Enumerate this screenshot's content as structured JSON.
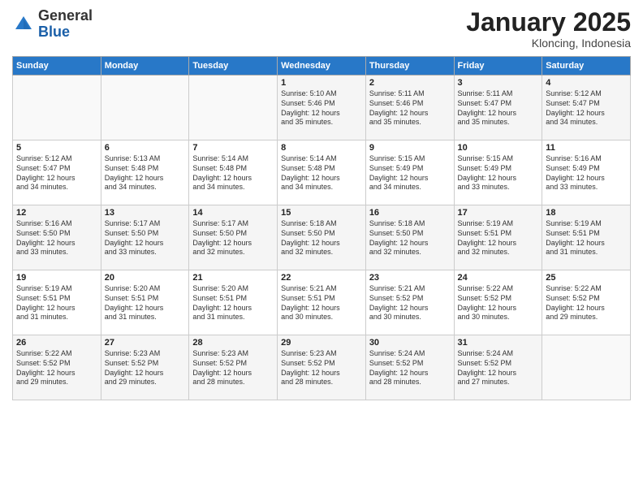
{
  "logo": {
    "general": "General",
    "blue": "Blue"
  },
  "header": {
    "month": "January 2025",
    "location": "Kloncing, Indonesia"
  },
  "weekdays": [
    "Sunday",
    "Monday",
    "Tuesday",
    "Wednesday",
    "Thursday",
    "Friday",
    "Saturday"
  ],
  "weeks": [
    [
      {
        "day": "",
        "content": ""
      },
      {
        "day": "",
        "content": ""
      },
      {
        "day": "",
        "content": ""
      },
      {
        "day": "1",
        "content": "Sunrise: 5:10 AM\nSunset: 5:46 PM\nDaylight: 12 hours\nand 35 minutes."
      },
      {
        "day": "2",
        "content": "Sunrise: 5:11 AM\nSunset: 5:46 PM\nDaylight: 12 hours\nand 35 minutes."
      },
      {
        "day": "3",
        "content": "Sunrise: 5:11 AM\nSunset: 5:47 PM\nDaylight: 12 hours\nand 35 minutes."
      },
      {
        "day": "4",
        "content": "Sunrise: 5:12 AM\nSunset: 5:47 PM\nDaylight: 12 hours\nand 34 minutes."
      }
    ],
    [
      {
        "day": "5",
        "content": "Sunrise: 5:12 AM\nSunset: 5:47 PM\nDaylight: 12 hours\nand 34 minutes."
      },
      {
        "day": "6",
        "content": "Sunrise: 5:13 AM\nSunset: 5:48 PM\nDaylight: 12 hours\nand 34 minutes."
      },
      {
        "day": "7",
        "content": "Sunrise: 5:14 AM\nSunset: 5:48 PM\nDaylight: 12 hours\nand 34 minutes."
      },
      {
        "day": "8",
        "content": "Sunrise: 5:14 AM\nSunset: 5:48 PM\nDaylight: 12 hours\nand 34 minutes."
      },
      {
        "day": "9",
        "content": "Sunrise: 5:15 AM\nSunset: 5:49 PM\nDaylight: 12 hours\nand 34 minutes."
      },
      {
        "day": "10",
        "content": "Sunrise: 5:15 AM\nSunset: 5:49 PM\nDaylight: 12 hours\nand 33 minutes."
      },
      {
        "day": "11",
        "content": "Sunrise: 5:16 AM\nSunset: 5:49 PM\nDaylight: 12 hours\nand 33 minutes."
      }
    ],
    [
      {
        "day": "12",
        "content": "Sunrise: 5:16 AM\nSunset: 5:50 PM\nDaylight: 12 hours\nand 33 minutes."
      },
      {
        "day": "13",
        "content": "Sunrise: 5:17 AM\nSunset: 5:50 PM\nDaylight: 12 hours\nand 33 minutes."
      },
      {
        "day": "14",
        "content": "Sunrise: 5:17 AM\nSunset: 5:50 PM\nDaylight: 12 hours\nand 32 minutes."
      },
      {
        "day": "15",
        "content": "Sunrise: 5:18 AM\nSunset: 5:50 PM\nDaylight: 12 hours\nand 32 minutes."
      },
      {
        "day": "16",
        "content": "Sunrise: 5:18 AM\nSunset: 5:50 PM\nDaylight: 12 hours\nand 32 minutes."
      },
      {
        "day": "17",
        "content": "Sunrise: 5:19 AM\nSunset: 5:51 PM\nDaylight: 12 hours\nand 32 minutes."
      },
      {
        "day": "18",
        "content": "Sunrise: 5:19 AM\nSunset: 5:51 PM\nDaylight: 12 hours\nand 31 minutes."
      }
    ],
    [
      {
        "day": "19",
        "content": "Sunrise: 5:19 AM\nSunset: 5:51 PM\nDaylight: 12 hours\nand 31 minutes."
      },
      {
        "day": "20",
        "content": "Sunrise: 5:20 AM\nSunset: 5:51 PM\nDaylight: 12 hours\nand 31 minutes."
      },
      {
        "day": "21",
        "content": "Sunrise: 5:20 AM\nSunset: 5:51 PM\nDaylight: 12 hours\nand 31 minutes."
      },
      {
        "day": "22",
        "content": "Sunrise: 5:21 AM\nSunset: 5:51 PM\nDaylight: 12 hours\nand 30 minutes."
      },
      {
        "day": "23",
        "content": "Sunrise: 5:21 AM\nSunset: 5:52 PM\nDaylight: 12 hours\nand 30 minutes."
      },
      {
        "day": "24",
        "content": "Sunrise: 5:22 AM\nSunset: 5:52 PM\nDaylight: 12 hours\nand 30 minutes."
      },
      {
        "day": "25",
        "content": "Sunrise: 5:22 AM\nSunset: 5:52 PM\nDaylight: 12 hours\nand 29 minutes."
      }
    ],
    [
      {
        "day": "26",
        "content": "Sunrise: 5:22 AM\nSunset: 5:52 PM\nDaylight: 12 hours\nand 29 minutes."
      },
      {
        "day": "27",
        "content": "Sunrise: 5:23 AM\nSunset: 5:52 PM\nDaylight: 12 hours\nand 29 minutes."
      },
      {
        "day": "28",
        "content": "Sunrise: 5:23 AM\nSunset: 5:52 PM\nDaylight: 12 hours\nand 28 minutes."
      },
      {
        "day": "29",
        "content": "Sunrise: 5:23 AM\nSunset: 5:52 PM\nDaylight: 12 hours\nand 28 minutes."
      },
      {
        "day": "30",
        "content": "Sunrise: 5:24 AM\nSunset: 5:52 PM\nDaylight: 12 hours\nand 28 minutes."
      },
      {
        "day": "31",
        "content": "Sunrise: 5:24 AM\nSunset: 5:52 PM\nDaylight: 12 hours\nand 27 minutes."
      },
      {
        "day": "",
        "content": ""
      }
    ]
  ]
}
